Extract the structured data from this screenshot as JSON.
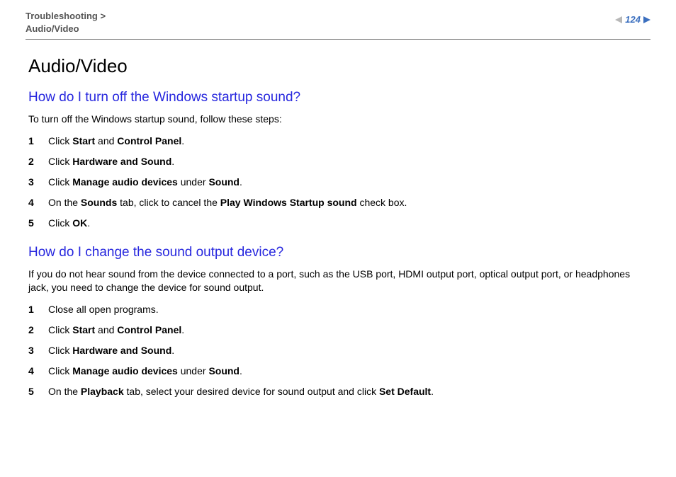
{
  "breadcrumb": {
    "parent": "Troubleshooting",
    "sep": ">",
    "current": "Audio/Video"
  },
  "page_number": "124",
  "title": "Audio/Video",
  "sections": [
    {
      "heading": "How do I turn off the Windows startup sound?",
      "intro": "To turn off the Windows startup sound, follow these steps:",
      "steps": [
        {
          "n": "1",
          "html": "Click <b>Start</b> and <b>Control Panel</b>."
        },
        {
          "n": "2",
          "html": "Click <b>Hardware and Sound</b>."
        },
        {
          "n": "3",
          "html": "Click <b>Manage audio devices</b> under <b>Sound</b>."
        },
        {
          "n": "4",
          "html": "On the <b>Sounds</b> tab, click to cancel the <b>Play Windows Startup sound</b> check box."
        },
        {
          "n": "5",
          "html": "Click <b>OK</b>."
        }
      ]
    },
    {
      "heading": "How do I change the sound output device?",
      "intro": "If you do not hear sound from the device connected to a port, such as the USB port, HDMI output port, optical output port, or headphones jack, you need to change the device for sound output.",
      "steps": [
        {
          "n": "1",
          "html": "Close all open programs."
        },
        {
          "n": "2",
          "html": "Click <b>Start</b> and <b>Control Panel</b>."
        },
        {
          "n": "3",
          "html": "Click <b>Hardware and Sound</b>."
        },
        {
          "n": "4",
          "html": "Click <b>Manage audio devices</b> under <b>Sound</b>."
        },
        {
          "n": "5",
          "html": "On the <b>Playback</b> tab, select your desired device for sound output and click <b>Set Default</b>."
        }
      ]
    }
  ]
}
